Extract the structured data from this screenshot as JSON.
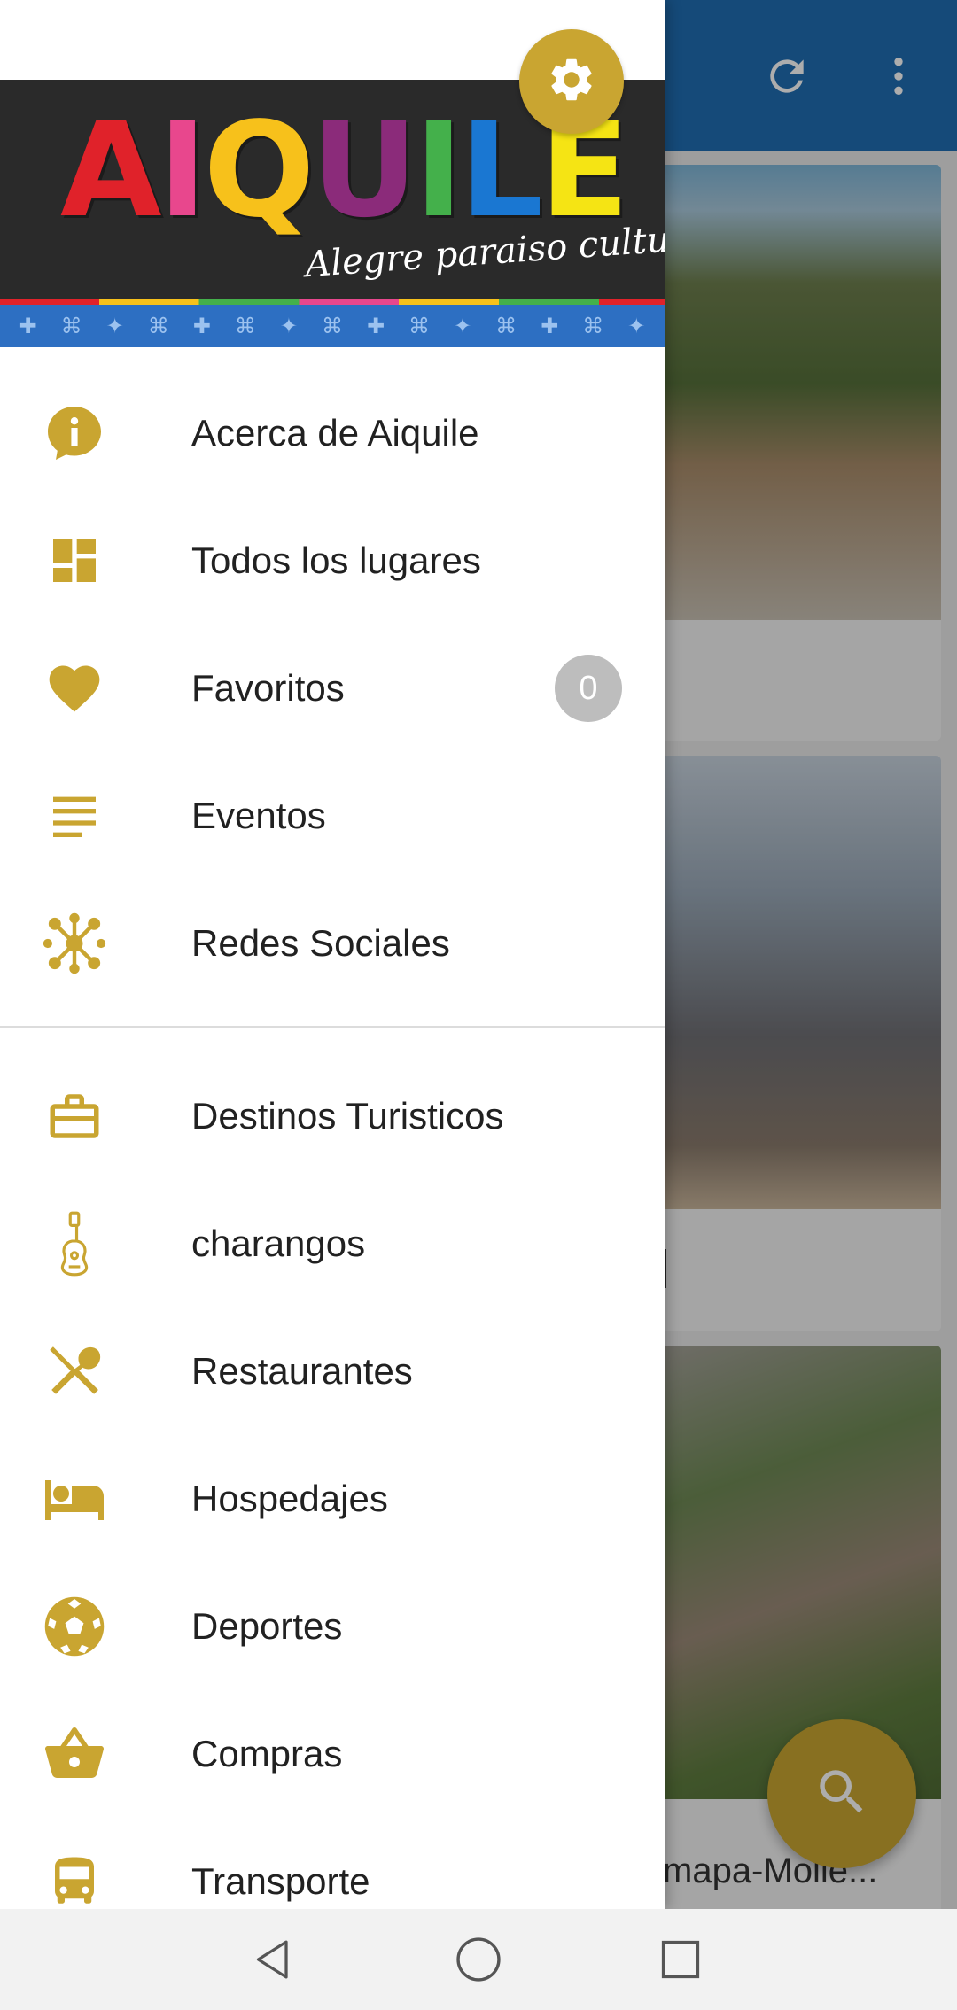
{
  "colors": {
    "accent": "#c9a531",
    "app_bar": "#1f6db3",
    "menu_text": "#212121",
    "badge_bg": "#bdbdbd",
    "logo_letters": [
      "#e0222a",
      "#e8478d",
      "#f7c11b",
      "#8b2b7a",
      "#44b04b",
      "#1a77d2",
      "#f5e414"
    ]
  },
  "header": {
    "logo_letters": [
      "A",
      "I",
      "Q",
      "U",
      "I",
      "L",
      "E"
    ],
    "tagline": "Alegre paraiso cultural",
    "settings_icon": "gear-icon"
  },
  "menu": {
    "primary": [
      {
        "label": "Acerca de Aiquile",
        "icon": "info-icon"
      },
      {
        "label": "Todos los lugares",
        "icon": "dashboard-icon"
      },
      {
        "label": "Favoritos",
        "icon": "heart-icon",
        "badge": "0"
      },
      {
        "label": "Eventos",
        "icon": "list-icon"
      },
      {
        "label": "Redes Sociales",
        "icon": "network-icon"
      }
    ],
    "categories": [
      {
        "label": "Destinos Turisticos",
        "icon": "briefcase-icon"
      },
      {
        "label": "charangos",
        "icon": "guitar-icon"
      },
      {
        "label": "Restaurantes",
        "icon": "utensils-icon"
      },
      {
        "label": "Hospedajes",
        "icon": "bed-icon"
      },
      {
        "label": "Deportes",
        "icon": "soccer-ball-icon"
      },
      {
        "label": "Compras",
        "icon": "basket-icon"
      },
      {
        "label": "Transporte",
        "icon": "bus-icon"
      }
    ]
  },
  "background": {
    "toolbar_icons": [
      "refresh-icon",
      "more-vert-icon"
    ],
    "card3_caption": "mapa-Molle...",
    "fab_icon": "search-icon"
  },
  "system_nav": {
    "icons": [
      "back-icon",
      "home-icon",
      "recents-icon"
    ]
  }
}
